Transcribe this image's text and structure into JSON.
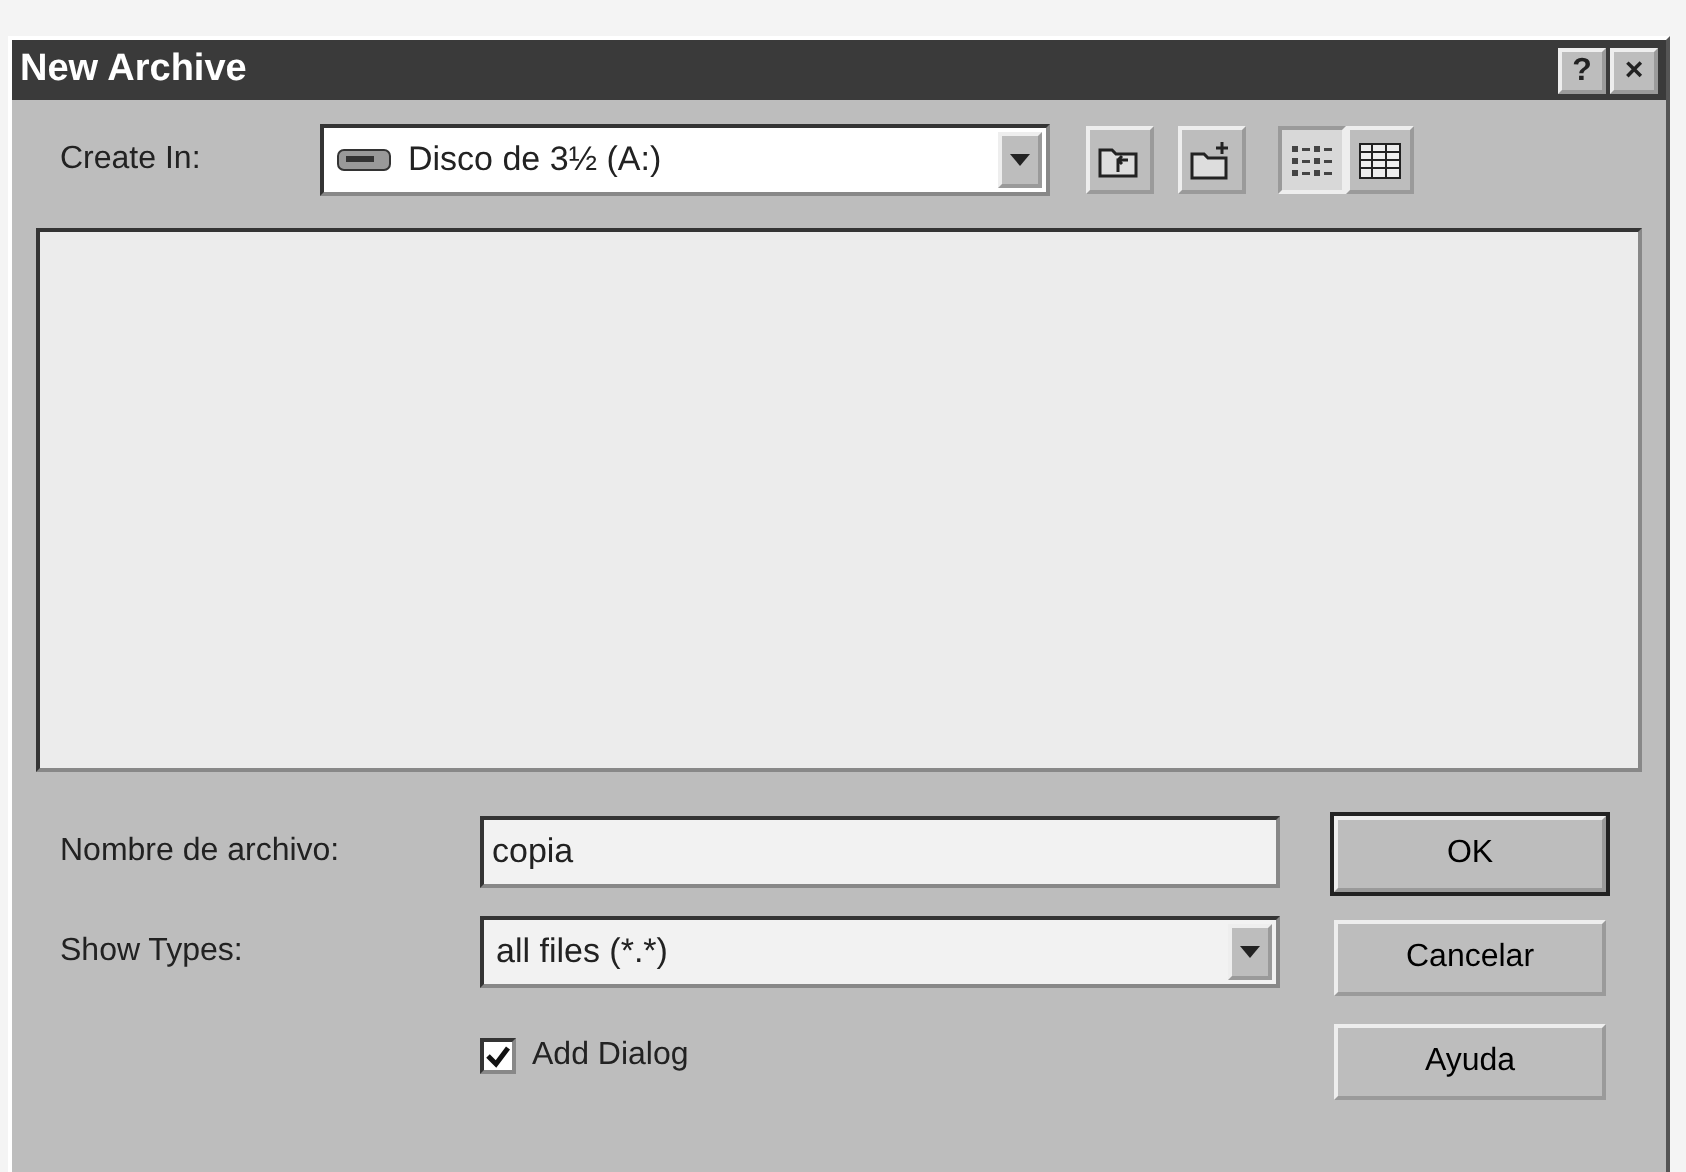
{
  "window": {
    "title": "New Archive",
    "controls": [
      "?",
      "×"
    ]
  },
  "create_in": {
    "label": "Create In:",
    "value": "Disco de 3½ (A:)"
  },
  "toolbar": [
    {
      "kind": "up-folder"
    },
    {
      "kind": "new-folder"
    },
    {
      "kind": "list",
      "selected": true
    },
    {
      "kind": "details",
      "selected": false
    }
  ],
  "file_name": {
    "label": "Nombre de archivo:",
    "value": "copia"
  },
  "show_types": {
    "label": "Show Types:",
    "value": "all files (*.*)"
  },
  "add_dialog": {
    "label": "Add Dialog",
    "checked": true
  },
  "buttons": [
    {
      "label": "OK",
      "default": true
    },
    {
      "label": "Cancelar",
      "default": false
    },
    {
      "label": "Ayuda",
      "default": false
    }
  ]
}
